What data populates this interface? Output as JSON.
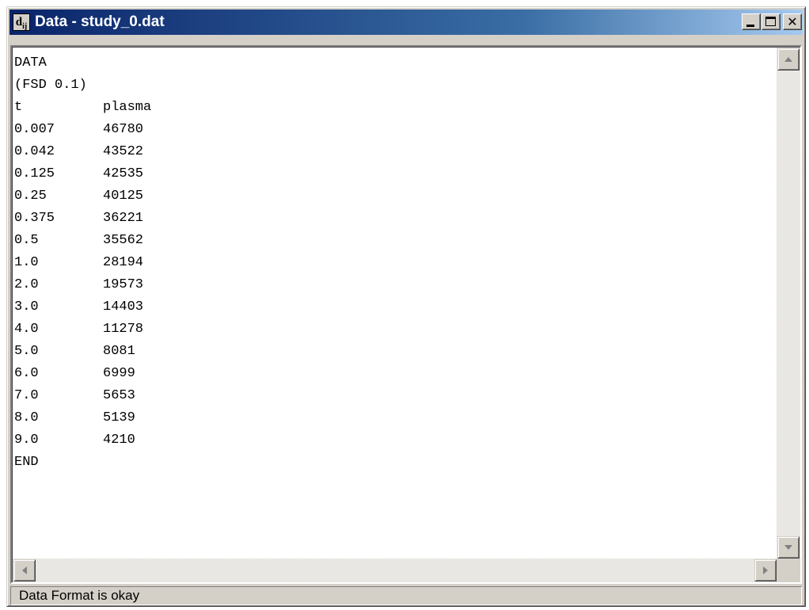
{
  "window": {
    "title": "Data - study_0.dat",
    "icon_label": "d",
    "icon_sub": "ij"
  },
  "editor": {
    "header_lines": [
      "DATA",
      "(FSD 0.1)"
    ],
    "columns": [
      "t",
      "plasma"
    ],
    "rows": [
      [
        "0.007",
        "46780"
      ],
      [
        "0.042",
        "43522"
      ],
      [
        "0.125",
        "42535"
      ],
      [
        "0.25",
        "40125"
      ],
      [
        "0.375",
        "36221"
      ],
      [
        "0.5",
        "35562"
      ],
      [
        "1.0",
        "28194"
      ],
      [
        "2.0",
        "19573"
      ],
      [
        "3.0",
        "14403"
      ],
      [
        "4.0",
        "11278"
      ],
      [
        "5.0",
        "8081"
      ],
      [
        "6.0",
        "6999"
      ],
      [
        "7.0",
        "5653"
      ],
      [
        "8.0",
        "5139"
      ],
      [
        "9.0",
        "4210"
      ]
    ],
    "footer_line": "END"
  },
  "status": {
    "text": "Data Format is okay"
  },
  "colors": {
    "titlebar_start": "#0a246a",
    "titlebar_end": "#a6caf0",
    "chrome": "#d4d0c8"
  }
}
